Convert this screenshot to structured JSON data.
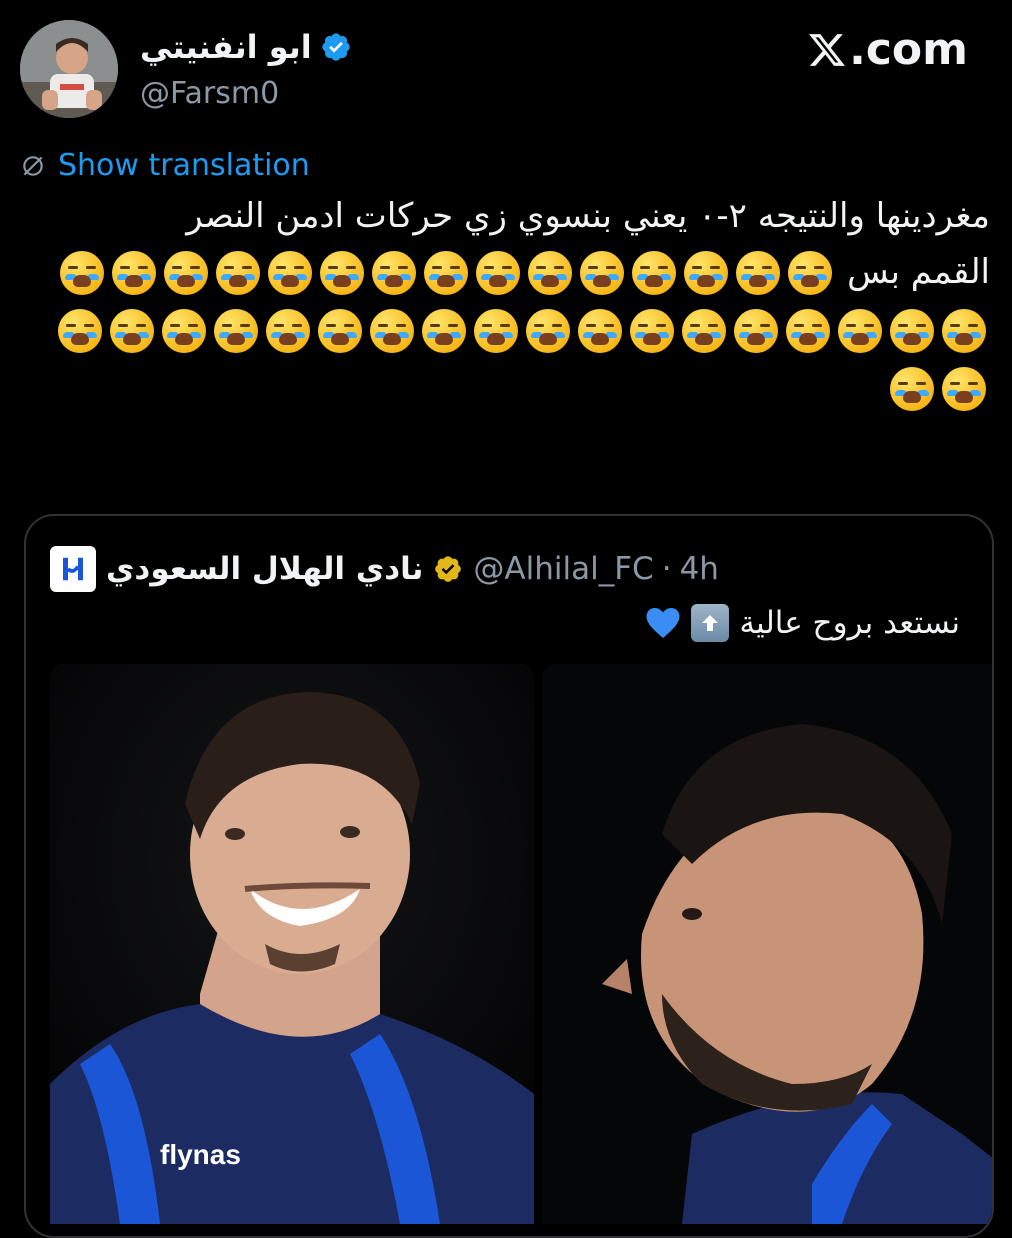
{
  "author": {
    "display_name": "ابو انفنيتي",
    "handle": "@Farsm0",
    "verified": true
  },
  "brand": {
    "label": ".com",
    "icon": "x-logo-icon"
  },
  "translation": {
    "label": "Show translation",
    "icon": "globe-slash-icon"
  },
  "tweet": {
    "line1": "مغردينها والنتيجه ٢-٠ يعني بنسوي زي حركات ادمن النصر",
    "line2": "القمم بس",
    "emoji_name": "loudly-crying-face-icon",
    "emoji_count": 35
  },
  "quote": {
    "display_name": "نادي الهلال السعودي",
    "handle": "@Alhilal_FC",
    "dot": "·",
    "time": "4h",
    "text": "نستعد بروح عالية",
    "logo_icon": "al-hilal-logo-icon",
    "media": [
      {
        "name": "player-photo-left",
        "icon": "player-photo"
      },
      {
        "name": "player-photo-right",
        "icon": "player-photo"
      }
    ],
    "sponsor_text": "flynas"
  },
  "colors": {
    "background": "#000000",
    "link_blue": "#1d9bf0",
    "muted": "#8b98a5",
    "verified_blue": "#1d9bf0",
    "verified_gold": "#e2b719",
    "kit_navy": "#1c2c63",
    "kit_blue": "#1b56d6"
  }
}
